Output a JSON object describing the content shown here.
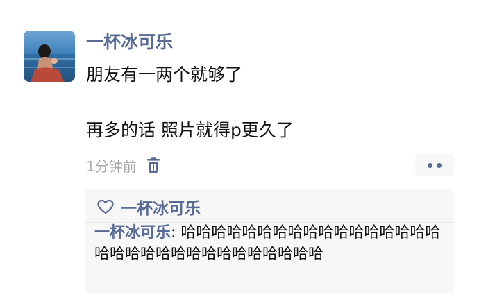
{
  "post": {
    "nickname": "一杯冰可乐",
    "text_lines": [
      "朋友有一两个就够了",
      "再多的话 照片就得p更久了"
    ],
    "timestamp": "1分钟前",
    "delete_icon": "trash-icon",
    "more_icon": "more-dots-icon"
  },
  "likes": {
    "icon": "heart-icon",
    "names": "一杯冰可乐"
  },
  "comments": [
    {
      "author": "一杯冰可乐",
      "separator": ": ",
      "text": "哈哈哈哈哈哈哈哈哈哈哈哈哈哈哈哈哈哈哈哈哈哈哈哈哈哈哈哈哈哈哈哈"
    }
  ],
  "colors": {
    "link_blue": "#576b95",
    "panel_bg": "#f7f7f7",
    "timestamp_gray": "#a7a7a7"
  }
}
